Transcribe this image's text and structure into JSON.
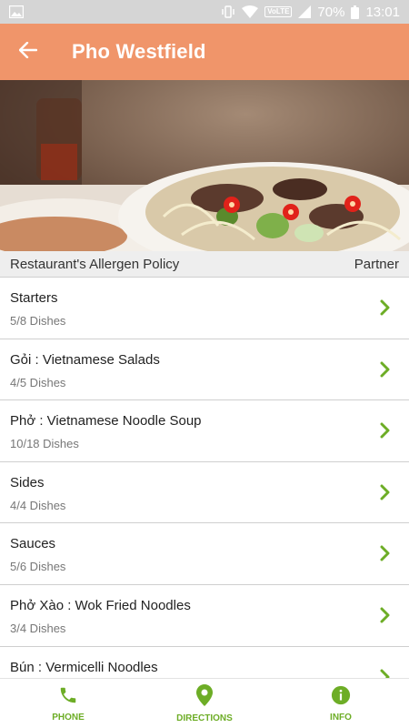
{
  "status_bar": {
    "network": "VoLTE",
    "battery": "70%",
    "time": "13:01"
  },
  "app_bar": {
    "title": "Pho Westfield",
    "color": "#f0956a"
  },
  "policy": {
    "label": "Restaurant's Allergen Policy",
    "partner": "Partner"
  },
  "categories": [
    {
      "name": "Starters",
      "count": "5/8 Dishes"
    },
    {
      "name": "Gỏi : Vietnamese Salads",
      "count": "4/5 Dishes"
    },
    {
      "name": "Phở : Vietnamese Noodle Soup",
      "count": "10/18 Dishes"
    },
    {
      "name": "Sides",
      "count": "4/4 Dishes"
    },
    {
      "name": "Sauces",
      "count": "5/6 Dishes"
    },
    {
      "name": "Phở Xào : Wok Fried Noodles",
      "count": "3/4 Dishes"
    },
    {
      "name": "Bún : Vermicelli Noodles",
      "count": ""
    }
  ],
  "bottom_nav": {
    "phone": "PHONE",
    "directions": "DIRECTIONS",
    "info": "INFO",
    "accent": "#6dad26"
  }
}
